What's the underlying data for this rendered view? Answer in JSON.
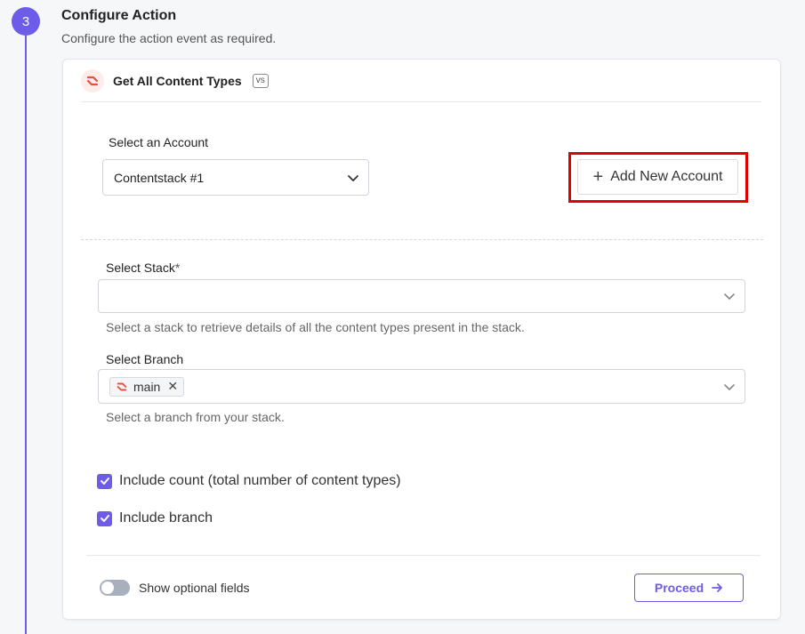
{
  "step": {
    "number": "3",
    "title": "Configure Action",
    "subtitle": "Configure the action event as required."
  },
  "action": {
    "title": "Get All Content Types",
    "badge": "vs",
    "icon": "contentstack-logo-icon"
  },
  "account": {
    "label": "Select an Account",
    "selected": "Contentstack #1",
    "add_button_label": "Add New Account"
  },
  "stack": {
    "label": "Select Stack",
    "required_mark": "*",
    "value": "",
    "help": "Select a stack to retrieve details of all the content types present in the stack."
  },
  "branch": {
    "label": "Select Branch",
    "chips": [
      "main"
    ],
    "help": "Select a branch from your stack."
  },
  "checkboxes": [
    {
      "label": "Include count (total number of content types)",
      "checked": true
    },
    {
      "label": "Include branch",
      "checked": true
    }
  ],
  "footer": {
    "toggle_label": "Show optional fields",
    "toggle_on": false,
    "proceed_label": "Proceed"
  },
  "colors": {
    "accent": "#6c5ce7",
    "highlight": "#e00000",
    "logo": "#e8513b"
  }
}
